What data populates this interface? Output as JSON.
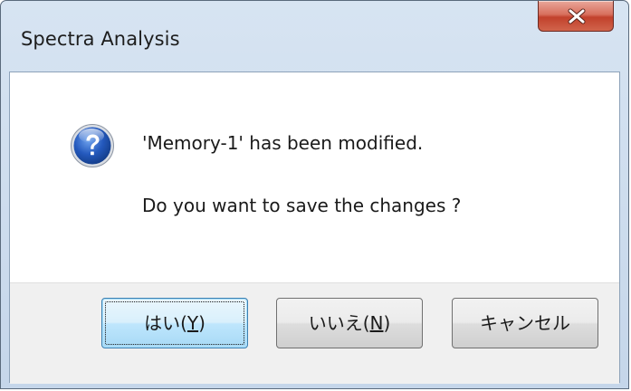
{
  "window": {
    "title": "Spectra Analysis"
  },
  "titlebar": {
    "close_icon": "close-x-icon"
  },
  "message": {
    "icon": "question-icon",
    "line1": "'Memory-1' has been modified.",
    "line2": "Do you want to save the changes ?"
  },
  "buttons": {
    "yes": {
      "prefix": "はい(",
      "mnemonic": "Y",
      "suffix": ")"
    },
    "no": {
      "prefix": "いいえ(",
      "mnemonic": "N",
      "suffix": ")"
    },
    "cancel": {
      "label": "キャンセル"
    }
  },
  "colors": {
    "close_button": "#c94e39",
    "default_button": "#bee6fd",
    "icon_blue": "#1f4fa8"
  }
}
